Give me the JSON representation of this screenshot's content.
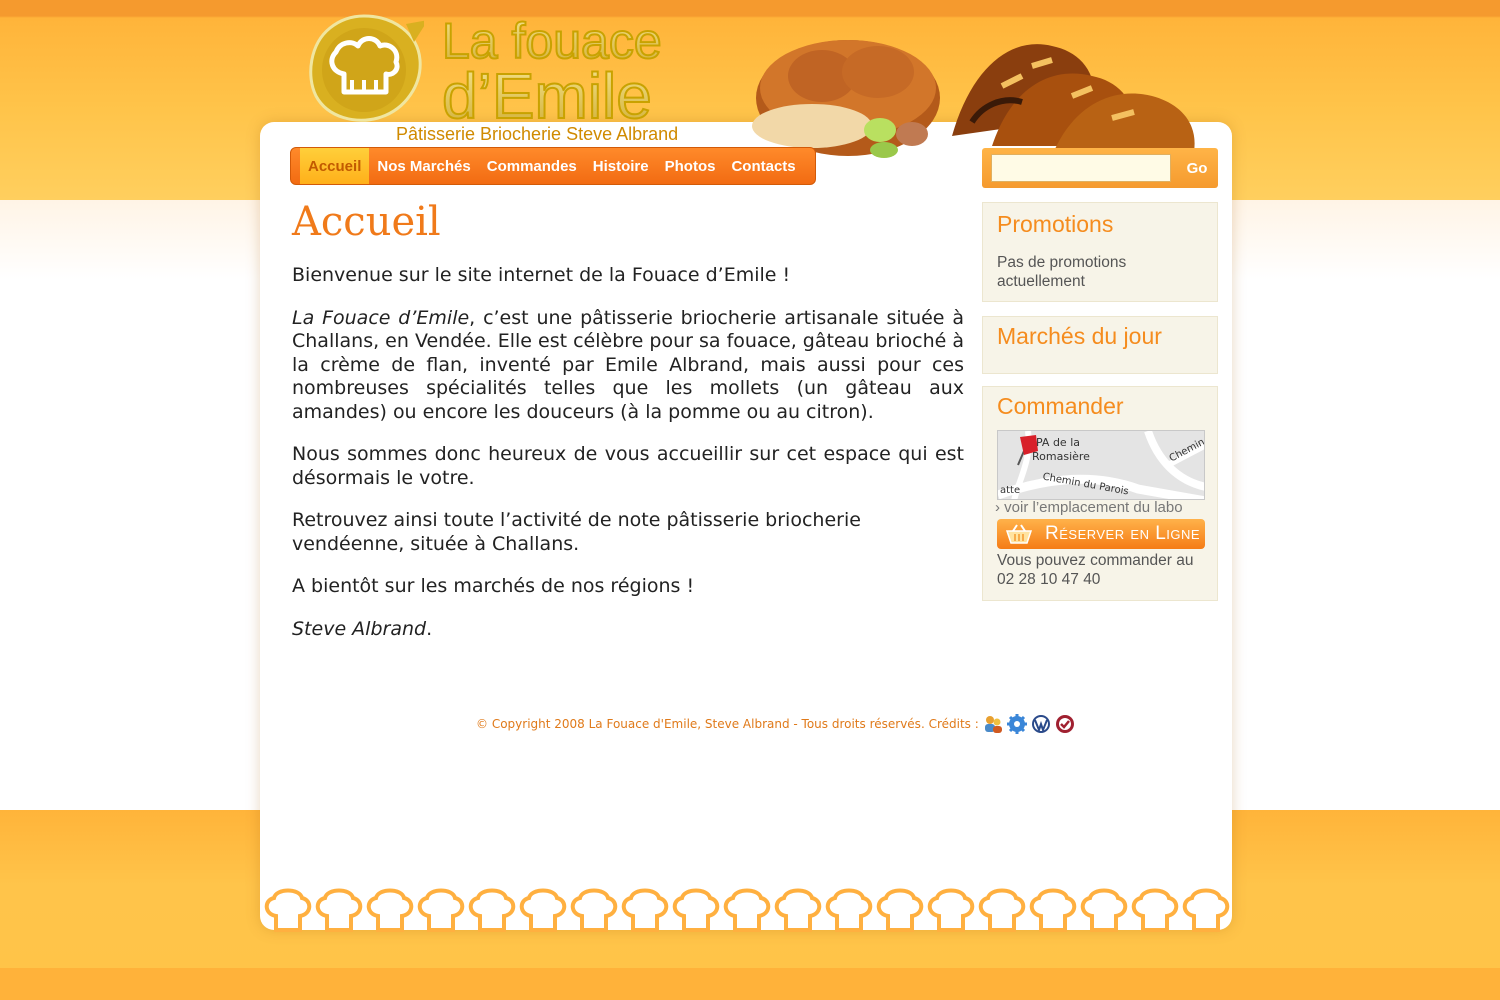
{
  "site": {
    "logo_line1": "La fouace",
    "logo_line2": "d’Emile",
    "tagline": "Pâtisserie Briocherie Steve Albrand"
  },
  "nav": {
    "items": [
      {
        "label": "Accueil",
        "active": true
      },
      {
        "label": "Nos Marchés"
      },
      {
        "label": "Commandes"
      },
      {
        "label": "Histoire"
      },
      {
        "label": "Photos"
      },
      {
        "label": "Contacts"
      }
    ]
  },
  "search": {
    "value": "",
    "button_label": "Go"
  },
  "main": {
    "title": "Accueil",
    "p1": "Bienvenue sur le site internet de la Fouace d’Emile !",
    "p2_italic": "La Fouace d’Emile",
    "p2_rest": ", c’est une pâtisserie briocherie artisanale située à Challans, en Vendée. Elle est célèbre pour sa fouace, gâteau brioché à la crème de flan, inventé par Emile Albrand, mais aussi pour ces nombreuses spécialités telles que les mollets (un gâteau aux amandes) ou encore les douceurs (à la pomme ou au citron).",
    "p3": "Nous sommes donc heureux de vous accueillir sur cet espace qui est désormais le votre.",
    "p4": "Retrouvez ainsi toute l’activité de note pâtisserie briocherie vendéenne, située à Challans.",
    "p5": "A bientôt sur les marchés de nos régions !",
    "signature": "Steve Albrand",
    "signature_end": "."
  },
  "sidebar": {
    "promotions": {
      "title": "Promotions",
      "text": "Pas de promotions actuellement"
    },
    "marches": {
      "title": "Marchés du jour"
    },
    "commander": {
      "title": "Commander",
      "map_labels": [
        "PA de la",
        "Romasière",
        "Chemin du Parois",
        "Chemin",
        "atte"
      ],
      "map_link": "› voir l’emplacement du labo",
      "reserve_label": "Réserver en Ligne",
      "text": "Vous pouvez commander au 02 28 10 47 40"
    }
  },
  "footer": {
    "copyright": "© Copyright 2008 La Fouace d'Emile, Steve Albrand - Tous droits réservés. Crédits :",
    "credit_icons": [
      "users-icon",
      "gear-icon",
      "wordpress-icon",
      "badge-icon"
    ]
  },
  "colors": {
    "accent": "#f58c1e",
    "nav": "#f26b12",
    "nav_active": "#ffbf2a",
    "title": "#f07a1a",
    "header_bg": "#ffc44a"
  }
}
